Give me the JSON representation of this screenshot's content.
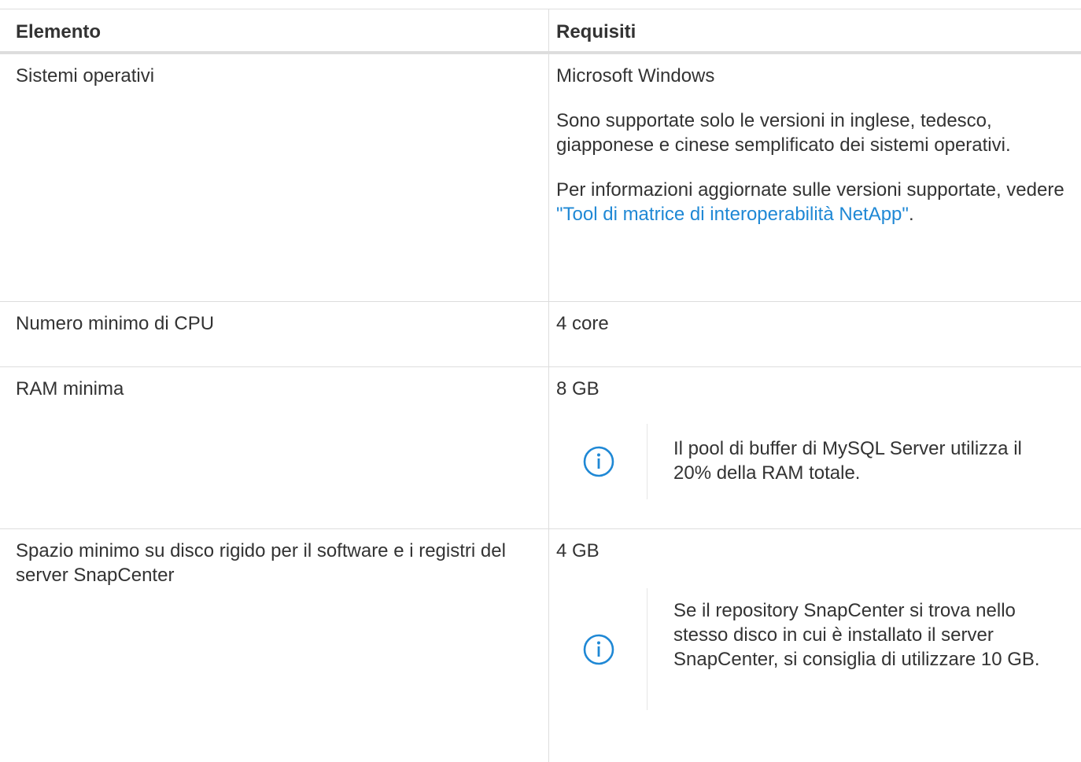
{
  "table": {
    "headers": [
      "Elemento",
      "Requisiti"
    ],
    "rows": [
      {
        "element": "Sistemi operativi",
        "req_main": "Microsoft Windows",
        "req_para1": "Sono supportate solo le versioni in inglese, tedesco, giapponese e cinese semplificato dei sistemi operativi.",
        "req_para2_prefix": "Per informazioni aggiornate sulle versioni supportate, vedere ",
        "req_para2_link": "\"Tool di matrice di interoperabilità NetApp\"",
        "req_para2_suffix": "."
      },
      {
        "element": "Numero minimo di CPU",
        "req_main": "4 core"
      },
      {
        "element": "RAM minima",
        "req_main": "8 GB",
        "note": "Il pool di buffer di MySQL Server utilizza il 20% della RAM totale."
      },
      {
        "element": "Spazio minimo su disco rigido per il software e i registri del server SnapCenter",
        "req_main": "4 GB",
        "note": "Se il repository SnapCenter si trova nello stesso disco in cui è installato il server SnapCenter, si consiglia di utilizzare 10 GB."
      }
    ]
  },
  "colors": {
    "text": "#333333",
    "link": "#1f88d5",
    "border": "#dddddd",
    "icon": "#1f88d5"
  },
  "icons": {
    "note": "info-icon"
  }
}
